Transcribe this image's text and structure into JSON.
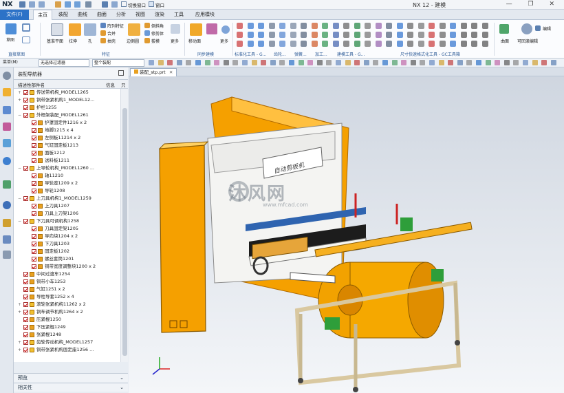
{
  "app": {
    "logo": "NX",
    "title": "NX 12 - 建模",
    "window_controls": "— ❐ ✕",
    "switch_window": "切换窗口",
    "window_menu": "窗口"
  },
  "menu": {
    "file": "文件(F)",
    "tabs": [
      "主页",
      "装配",
      "曲线",
      "曲面",
      "分析",
      "视图",
      "渲染",
      "工具",
      "应用模块"
    ],
    "active": "主页"
  },
  "ribbon": {
    "buttons": [
      "草图",
      "基准平面",
      "拉伸",
      "孔",
      "阵列特征",
      "合并",
      "抽壳",
      "边倒圆",
      "倒斜角",
      "修剪体",
      "拔模",
      "更多",
      "移动面",
      "偏置区域",
      "更多",
      "曲面",
      "编辑",
      "可回滚编辑"
    ],
    "groups": [
      "直接草图",
      "特征",
      "同步建模",
      "标准化工具 - G...",
      "齿轮...",
      "弹簧...",
      "加工...",
      "建模工具 - G...",
      "尺寸快速格式化工具 - GC工具箱"
    ],
    "colors": {
      "accent": "#2c72c7",
      "orange": "#f5a000",
      "group_text": "#2c5a96"
    }
  },
  "cmdbar": {
    "menu": "菜单(M)",
    "filter": "无选择过滤器",
    "scope": "整个装配"
  },
  "nav": {
    "title": "装配导航器",
    "col_name": "描述性部件名",
    "col_info": "信息",
    "col_flag": "只"
  },
  "tree": [
    {
      "indent": 1,
      "toggle": "+",
      "type": "asm",
      "label": "传送带机构_MODEL1265"
    },
    {
      "indent": 1,
      "toggle": "+",
      "type": "asm",
      "label": "铜带张紧机构1_MODEL12..."
    },
    {
      "indent": 1,
      "toggle": "",
      "type": "part",
      "label": "护栏1255"
    },
    {
      "indent": 1,
      "toggle": "−",
      "type": "asm",
      "label": "外框架装配_MODEL1261"
    },
    {
      "indent": 2,
      "toggle": "",
      "type": "part",
      "label": "护罩固定件1216 x 2"
    },
    {
      "indent": 2,
      "toggle": "",
      "type": "part",
      "label": "地脚1215 x 4"
    },
    {
      "indent": 2,
      "toggle": "",
      "type": "part",
      "label": "左侧板11214 x 2"
    },
    {
      "indent": 2,
      "toggle": "",
      "type": "part",
      "label": "气缸固定板1213"
    },
    {
      "indent": 2,
      "toggle": "",
      "type": "part",
      "label": "面板1212"
    },
    {
      "indent": 2,
      "toggle": "",
      "type": "part",
      "label": "送料板1211"
    },
    {
      "indent": 1,
      "toggle": "−",
      "type": "asm",
      "label": "上导轮机构_MODEL1260 ..."
    },
    {
      "indent": 2,
      "toggle": "",
      "type": "part",
      "label": "轴11210"
    },
    {
      "indent": 2,
      "toggle": "",
      "type": "part",
      "label": "导轮座1209 x 2"
    },
    {
      "indent": 2,
      "toggle": "",
      "type": "part",
      "label": "导轮1208"
    },
    {
      "indent": 1,
      "toggle": "−",
      "type": "asm",
      "label": "上刀具机构1_MODEL1259"
    },
    {
      "indent": 2,
      "toggle": "",
      "type": "part",
      "label": "上刀具1207"
    },
    {
      "indent": 2,
      "toggle": "",
      "type": "part",
      "label": "刀具上刀架1206"
    },
    {
      "indent": 1,
      "toggle": "−",
      "type": "asm",
      "label": "下刀具可调机构1258"
    },
    {
      "indent": 2,
      "toggle": "",
      "type": "part",
      "label": "刀具固定架1205"
    },
    {
      "indent": 2,
      "toggle": "",
      "type": "part",
      "label": "导向块1204 x 2"
    },
    {
      "indent": 2,
      "toggle": "",
      "type": "part",
      "label": "下刀具1203"
    },
    {
      "indent": 2,
      "toggle": "",
      "type": "part",
      "label": "固定板1202"
    },
    {
      "indent": 2,
      "toggle": "",
      "type": "part",
      "label": "螺丝套筒1201"
    },
    {
      "indent": 2,
      "toggle": "",
      "type": "part",
      "label": "铜带宽度调整块1200 x 2"
    },
    {
      "indent": 1,
      "toggle": "",
      "type": "part",
      "label": "中间过渡车1254"
    },
    {
      "indent": 1,
      "toggle": "",
      "type": "part",
      "label": "铜带小车1253"
    },
    {
      "indent": 1,
      "toggle": "",
      "type": "part",
      "label": "气缸1251 x 2"
    },
    {
      "indent": 1,
      "toggle": "",
      "type": "part",
      "label": "导柱导套1252 x 4"
    },
    {
      "indent": 1,
      "toggle": "+",
      "type": "asm",
      "label": "滚轮张紧机构11262 x 2"
    },
    {
      "indent": 1,
      "toggle": "+",
      "type": "asm",
      "label": "铜车调节机构1264 x 2"
    },
    {
      "indent": 1,
      "toggle": "",
      "type": "part",
      "label": "压紧棍1250"
    },
    {
      "indent": 1,
      "toggle": "",
      "type": "part",
      "label": "下压紧棍1249"
    },
    {
      "indent": 1,
      "toggle": "",
      "type": "part",
      "label": "张紧棍1248"
    },
    {
      "indent": 1,
      "toggle": "+",
      "type": "asm",
      "label": "齿轮传动机构_MODEL1257"
    },
    {
      "indent": 1,
      "toggle": "+",
      "type": "asm",
      "label": "铜带张紧机构固定座1256 ..."
    }
  ],
  "panes": {
    "preview": "预览",
    "dependencies": "相关性"
  },
  "doc": {
    "tab": "装配_stp.prt"
  },
  "viewport": {
    "banner": "自动剪板机",
    "watermark": "沐风网",
    "watermark_url": "www.mfcad.com"
  }
}
